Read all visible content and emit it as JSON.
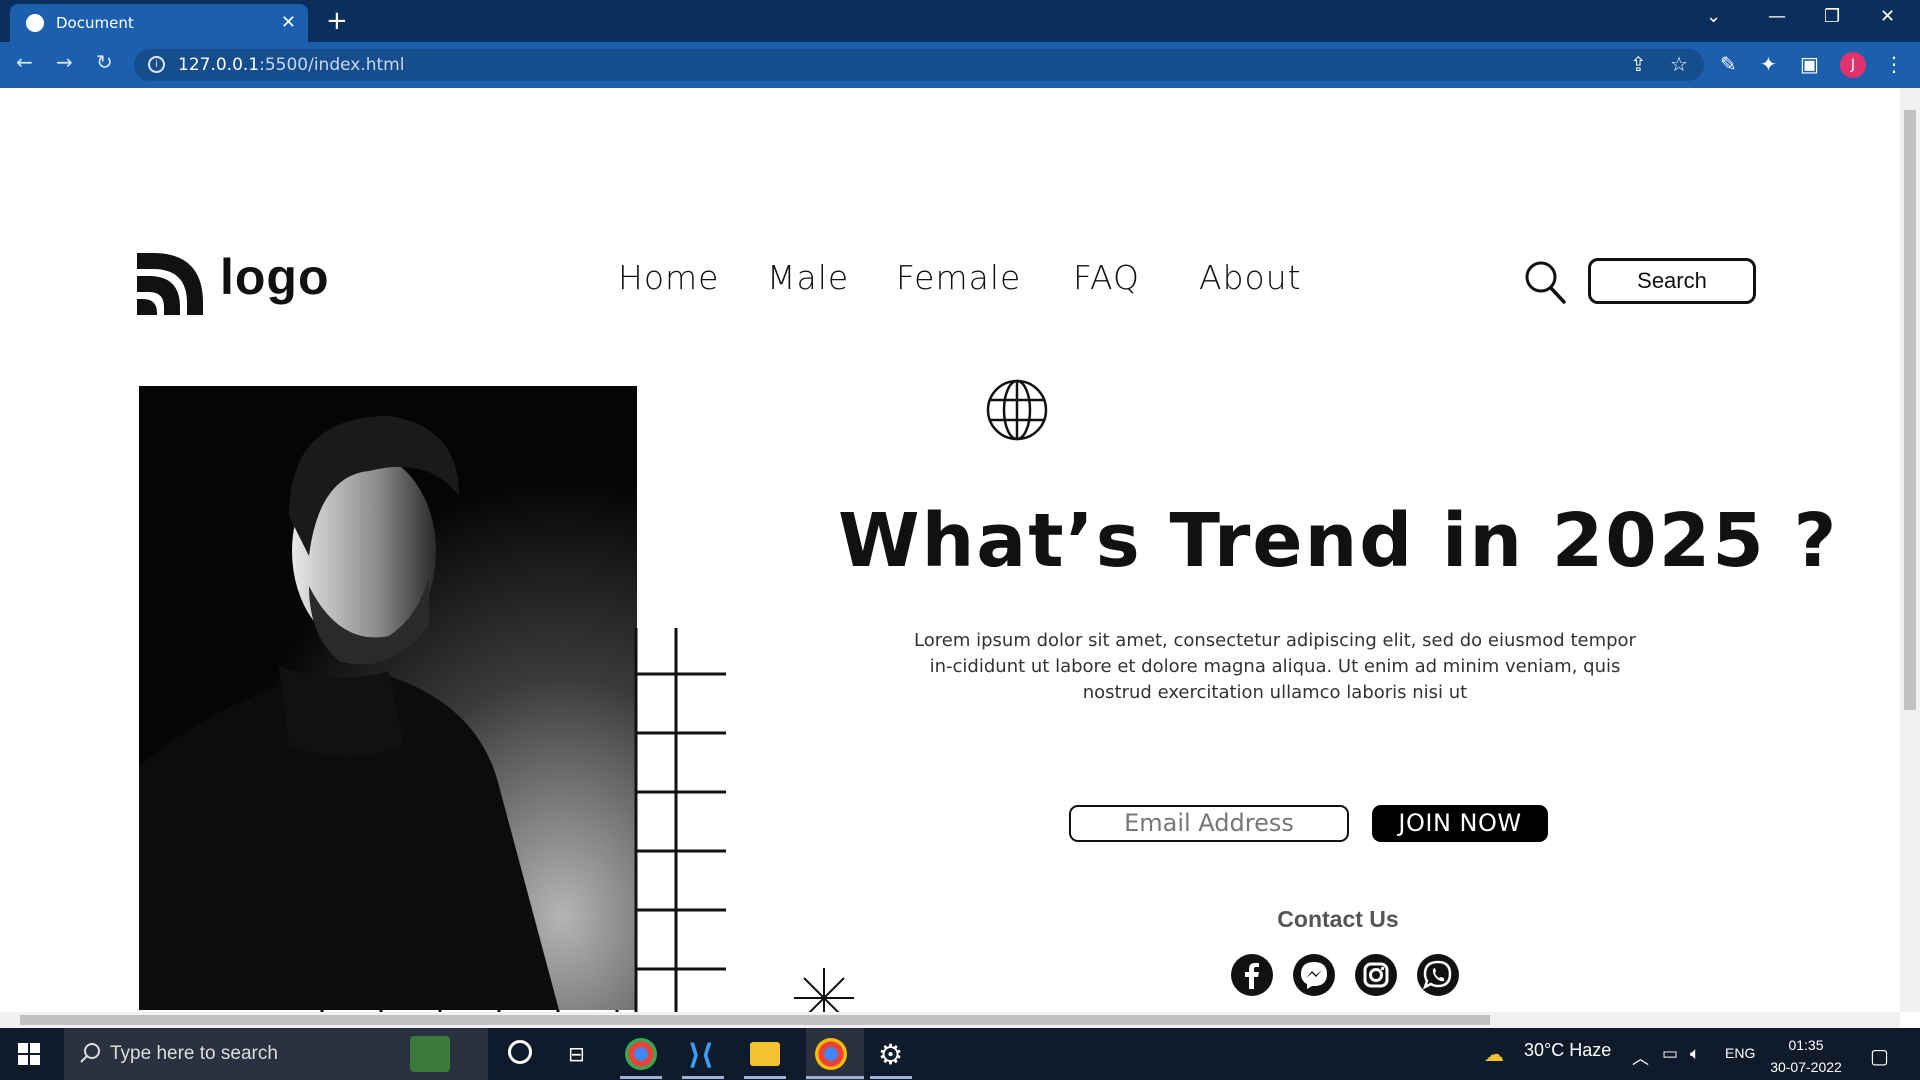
{
  "browser": {
    "tab_title": "Document",
    "url_host": "127.0.0.1",
    "url_path": ":5500/index.html",
    "profile_initial": "J"
  },
  "site": {
    "logo_text": "logo",
    "nav": [
      "Home",
      "Male",
      "Female",
      "FAQ",
      "About"
    ],
    "search_label": "Search",
    "headline": "What’s Trend in 2025 ?",
    "description": "Lorem ipsum dolor sit amet, consectetur adipiscing elit, sed do eiusmod tempor in-cididunt ut labore et dolore magna aliqua. Ut enim ad minim veniam, quis nostrud exercitation ullamco laboris nisi ut",
    "email_placeholder": "Email Address",
    "join_label": "JOIN NOW",
    "contact_title": "Contact Us",
    "social_icons": [
      "facebook-icon",
      "messenger-icon",
      "instagram-icon",
      "whatsapp-icon"
    ]
  },
  "taskbar": {
    "search_placeholder": "Type here to search",
    "weather": "30°C  Haze",
    "language": "ENG",
    "time": "01:35",
    "date": "30-07-2022"
  },
  "colors": {
    "chrome_dark": "#0a2f5c",
    "chrome_light": "#1b5fae",
    "text": "#111111",
    "taskbar": "#0f1b2a"
  }
}
